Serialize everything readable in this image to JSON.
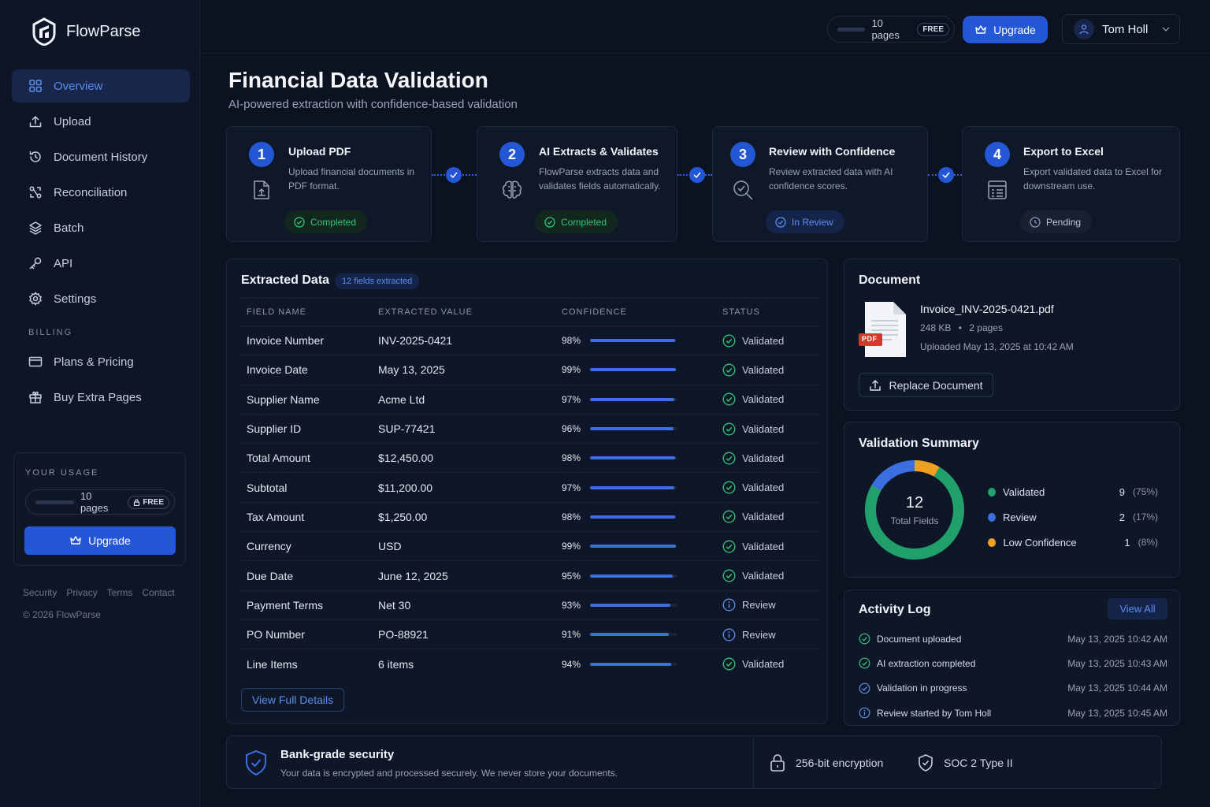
{
  "app": {
    "name": "FlowParse"
  },
  "sidebar": {
    "items": [
      {
        "label": "Overview",
        "icon": "grid-icon"
      },
      {
        "label": "Upload",
        "icon": "upload-icon"
      },
      {
        "label": "Document History",
        "icon": "history-icon"
      },
      {
        "label": "Reconciliation",
        "icon": "reconciliation-icon"
      },
      {
        "label": "Batch",
        "icon": "layers-icon"
      },
      {
        "label": "API",
        "icon": "key-icon"
      },
      {
        "label": "Settings",
        "icon": "gear-icon"
      }
    ],
    "billing_heading": "BILLING",
    "billing_items": [
      {
        "label": "Plans & Pricing",
        "icon": "credit-card-icon"
      },
      {
        "label": "Buy Extra Pages",
        "icon": "gift-icon"
      }
    ],
    "usage": {
      "title": "YOUR USAGE",
      "pages": "10 pages",
      "plan": "FREE",
      "used_fraction": 0.0,
      "upgrade_label": "Upgrade"
    },
    "footer_links": [
      "Security",
      "Privacy",
      "Terms",
      "Contact"
    ],
    "copyright": "© 2026 FlowParse"
  },
  "topbar": {
    "pages": "10 pages",
    "plan": "FREE",
    "upgrade_label": "Upgrade",
    "user_name": "Tom Holl"
  },
  "header": {
    "title": "Financial Data Validation",
    "subtitle": "AI-powered extraction with confidence-based validation"
  },
  "steps": [
    {
      "number": "1",
      "title": "Upload PDF",
      "description": "Upload financial documents in PDF format.",
      "status": "Completed",
      "icon": "pdf-upload-icon"
    },
    {
      "number": "2",
      "title": "AI Extracts & Validates",
      "description": "FlowParse extracts data and validates fields automatically.",
      "status": "Completed",
      "icon": "brain-icon"
    },
    {
      "number": "3",
      "title": "Review with Confidence",
      "description": "Review extracted data with AI confidence scores.",
      "status": "In Review",
      "icon": "review-search-icon"
    },
    {
      "number": "4",
      "title": "Export to Excel",
      "description": "Export validated data to Excel for downstream use.",
      "status": "Pending",
      "icon": "spreadsheet-icon"
    }
  ],
  "extracted": {
    "title": "Extracted Data",
    "count_label": "12 fields extracted",
    "columns": [
      "FIELD NAME",
      "EXTRACTED VALUE",
      "CONFIDENCE",
      "STATUS"
    ],
    "rows": [
      {
        "field": "Invoice Number",
        "value": "INV-2025-0421",
        "confidence": "98%",
        "status": "Validated"
      },
      {
        "field": "Invoice Date",
        "value": "May 13, 2025",
        "confidence": "99%",
        "status": "Validated"
      },
      {
        "field": "Supplier Name",
        "value": "Acme Ltd",
        "confidence": "97%",
        "status": "Validated"
      },
      {
        "field": "Supplier ID",
        "value": "SUP-77421",
        "confidence": "96%",
        "status": "Validated"
      },
      {
        "field": "Total Amount",
        "value": "$12,450.00",
        "confidence": "98%",
        "status": "Validated"
      },
      {
        "field": "Subtotal",
        "value": "$11,200.00",
        "confidence": "97%",
        "status": "Validated"
      },
      {
        "field": "Tax Amount",
        "value": "$1,250.00",
        "confidence": "98%",
        "status": "Validated"
      },
      {
        "field": "Currency",
        "value": "USD",
        "confidence": "99%",
        "status": "Validated"
      },
      {
        "field": "Due Date",
        "value": "June 12, 2025",
        "confidence": "95%",
        "status": "Validated"
      },
      {
        "field": "Payment Terms",
        "value": "Net 30",
        "confidence": "93%",
        "status": "Review"
      },
      {
        "field": "PO Number",
        "value": "PO-88921",
        "confidence": "91%",
        "status": "Review"
      },
      {
        "field": "Line Items",
        "value": "6 items",
        "confidence": "94%",
        "status": "Validated"
      }
    ],
    "view_details_label": "View Full Details"
  },
  "document": {
    "title": "Document",
    "file_badge": "PDF",
    "file_name": "Invoice_INV-2025-0421.pdf",
    "size": "248 KB",
    "pages": "2 pages",
    "uploaded": "Uploaded May 13, 2025 at 10:42 AM",
    "replace_label": "Replace Document"
  },
  "validation_summary": {
    "title": "Validation Summary",
    "total": "12",
    "total_label": "Total Fields",
    "items": [
      {
        "label": "Validated",
        "count": "9",
        "pct": "(75%)",
        "value": 9,
        "color": "#22a06b"
      },
      {
        "label": "Review",
        "count": "2",
        "pct": "(17%)",
        "value": 2,
        "color": "#3b6fe0"
      },
      {
        "label": "Low Confidence",
        "count": "1",
        "pct": "(8%)",
        "value": 1,
        "color": "#f0a020"
      }
    ]
  },
  "activity": {
    "title": "Activity Log",
    "view_all_label": "View All",
    "items": [
      {
        "text": "Document uploaded",
        "time": "May 13, 2025 10:42 AM",
        "kind": "check"
      },
      {
        "text": "AI extraction completed",
        "time": "May 13, 2025 10:43 AM",
        "kind": "check"
      },
      {
        "text": "Validation in progress",
        "time": "May 13, 2025 10:44 AM",
        "kind": "progress"
      },
      {
        "text": "Review started by Tom Holl",
        "time": "May 13, 2025 10:45 AM",
        "kind": "info"
      }
    ]
  },
  "security": {
    "title": "Bank-grade security",
    "description": "Your data is encrypted and processed securely. We never store your documents.",
    "features": [
      {
        "label": "256-bit encryption",
        "icon": "lock-icon"
      },
      {
        "label": "SOC 2 Type II",
        "icon": "shield-check-icon"
      }
    ]
  },
  "colors": {
    "accent": "#2457d6",
    "success": "#33c47a",
    "info": "#5b8df0",
    "warning": "#f0a020",
    "background": "#0b1220"
  }
}
